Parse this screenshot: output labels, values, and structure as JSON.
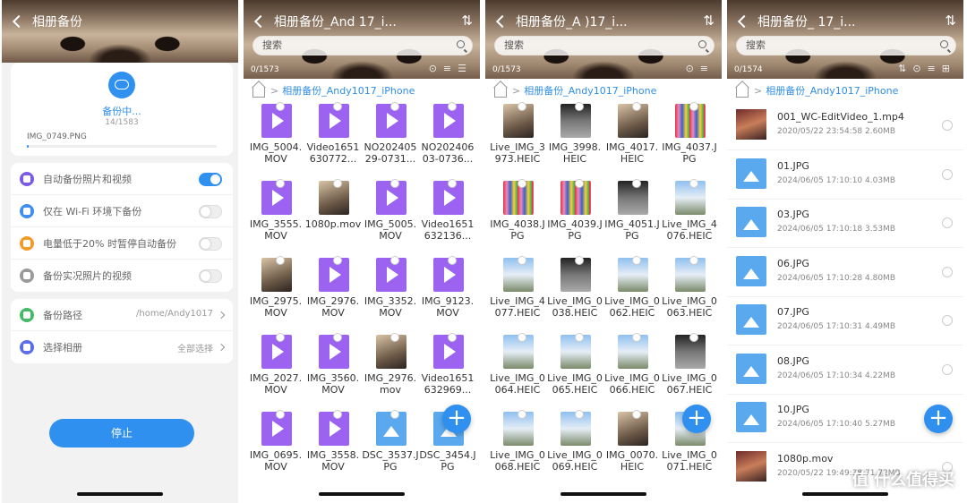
{
  "panel1": {
    "title": "相册备份",
    "status": "备份中...",
    "progress_count": "14/1583",
    "current_file": "IMG_0749.PNG",
    "progress_fraction": 0.009,
    "settings": [
      {
        "label": "自动备份照片和视频",
        "on": true,
        "icon_color": "#7b5be6"
      },
      {
        "label": "仅在 Wi-Fi 环境下备份",
        "on": false,
        "icon_color": "#3f8ef0"
      },
      {
        "label": "电量低于20% 时暂停自动备份",
        "on": false,
        "icon_color": "#f39a2b"
      },
      {
        "label": "备份实况照片的视频",
        "on": false,
        "icon_color": "#9a9a9a"
      }
    ],
    "path_label": "备份路径",
    "path_value": "/home/Andy1017",
    "album_label": "选择相册",
    "album_value": "全部选择",
    "stop_label": "停止"
  },
  "panel2": {
    "title": "相册备份_And   17_i...",
    "search_placeholder": "搜索",
    "counter": "0/1573",
    "breadcrumb": "相册备份_Andy1017_iPhone",
    "items": [
      [
        "IMG_5004.MOV",
        "video"
      ],
      [
        "Video1651630772...",
        "video"
      ],
      [
        "NO20240529-0731...",
        "video"
      ],
      [
        "NO20240603-0736...",
        "video"
      ],
      [
        "IMG_3555.MOV",
        "video"
      ],
      [
        "1080p.mov",
        "photo"
      ],
      [
        "IMG_5005.MOV",
        "video"
      ],
      [
        "Video1651632136...",
        "video"
      ],
      [
        "IMG_2975.MOV",
        "photo"
      ],
      [
        "IMG_2976.MOV",
        "video"
      ],
      [
        "IMG_3352.MOV",
        "video"
      ],
      [
        "IMG_9123.MOV",
        "video"
      ],
      [
        "IMG_2027.MOV",
        "video"
      ],
      [
        "IMG_3560.MOV",
        "video"
      ],
      [
        "IMG_2976.mov",
        "photo"
      ],
      [
        "Video1651632969...",
        "video"
      ],
      [
        "IMG_0695.MOV",
        "video"
      ],
      [
        "IMG_3558.MOV",
        "video"
      ],
      [
        "DSC_3537.JPG",
        "img"
      ],
      [
        "DSC_3454.JPG",
        "img"
      ]
    ]
  },
  "panel3": {
    "title": "相册备份_A    )17_i...",
    "search_placeholder": "搜索",
    "counter": "0/1573",
    "breadcrumb": "相册备份_Andy1017_iPhone",
    "items": [
      [
        "Live_IMG_3973.HEIC",
        "photo"
      ],
      [
        "IMG_3998.HEIC",
        "photo4"
      ],
      [
        "IMG_4017.HEIC",
        "photo"
      ],
      [
        "IMG_4037.JPG",
        "photo3"
      ],
      [
        "IMG_4038.JPG",
        "photo3"
      ],
      [
        "IMG_4039.JPG",
        "photo3"
      ],
      [
        "IMG_4051.JPG",
        "photo4"
      ],
      [
        "Live_IMG_4076.HEIC",
        "photo2"
      ],
      [
        "Live_IMG_4077.HEIC",
        "photo2"
      ],
      [
        "Live_IMG_0038.HEIC",
        "photo4"
      ],
      [
        "Live_IMG_0062.HEIC",
        "photo2"
      ],
      [
        "Live_IMG_0063.HEIC",
        "photo2"
      ],
      [
        "Live_IMG_0064.HEIC",
        "photo2"
      ],
      [
        "Live_IMG_0065.HEIC",
        "photo2"
      ],
      [
        "Live_IMG_0066.HEIC",
        "photo2"
      ],
      [
        "Live_IMG_0067.HEIC",
        "photo4"
      ],
      [
        "Live_IMG_0068.HEIC",
        "photo2"
      ],
      [
        "Live_IMG_0069.HEIC",
        "photo2"
      ],
      [
        "IMG_0070.HEIC",
        "photo"
      ],
      [
        "Live_IMG_0071.HEIC",
        "photo2"
      ]
    ]
  },
  "panel4": {
    "title": "相册备份_        17_i...",
    "search_placeholder": "搜索",
    "counter": "0/1574",
    "breadcrumb": "相册备份_Andy1017_iPhone",
    "files": [
      {
        "name": "001_WC-EditVideo_1.mp4",
        "meta": "2020/05/22 23:54:58 2.60MB",
        "kind": "vid"
      },
      {
        "name": "01.JPG",
        "meta": "2024/06/05 17:10:10 4.03MB",
        "kind": "img"
      },
      {
        "name": "03.JPG",
        "meta": "2024/06/05 17:10:18 3.53MB",
        "kind": "img"
      },
      {
        "name": "06.JPG",
        "meta": "2024/06/05 17:10:28 4.80MB",
        "kind": "img"
      },
      {
        "name": "07.JPG",
        "meta": "2024/06/05 17:10:31 4.49MB",
        "kind": "img"
      },
      {
        "name": "08.JPG",
        "meta": "2024/06/05 17:10:34 4.22MB",
        "kind": "img"
      },
      {
        "name": "10.JPG",
        "meta": "2024/06/05 17:10:40 5.27MB",
        "kind": "img"
      },
      {
        "name": "1080p.mov",
        "meta": "2020/05/22 19:49:38 71.72MB",
        "kind": "vid"
      }
    ]
  },
  "watermark": "值 什么值得买",
  "fab_symbol": "+"
}
